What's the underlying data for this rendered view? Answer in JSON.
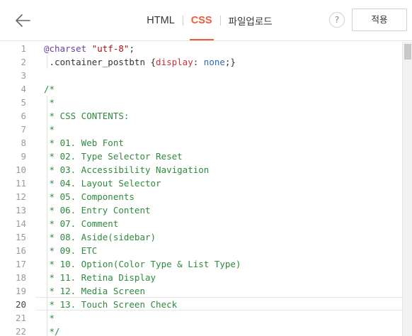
{
  "toolbar": {
    "tabs": [
      "HTML",
      "CSS",
      "파일업로드"
    ],
    "active_tab": "CSS",
    "help_label": "?",
    "apply_label": "적용"
  },
  "editor": {
    "current_line": 20,
    "lines": [
      {
        "num": "1",
        "tokens": [
          [
            "at",
            "@charset"
          ],
          [
            "punct",
            " "
          ],
          [
            "str",
            "\"utf-8\""
          ],
          [
            "punct",
            ";"
          ]
        ]
      },
      {
        "num": "2",
        "tokens": [
          [
            "sel",
            " .container_postbtn "
          ],
          [
            "punct",
            "{"
          ],
          [
            "prop",
            "display"
          ],
          [
            "punct",
            ": "
          ],
          [
            "val",
            "none"
          ],
          [
            "punct",
            ";}"
          ]
        ]
      },
      {
        "num": "3",
        "tokens": []
      },
      {
        "num": "4",
        "tokens": [
          [
            "comment",
            "/*"
          ]
        ]
      },
      {
        "num": "5",
        "tokens": [
          [
            "comment",
            " *"
          ]
        ]
      },
      {
        "num": "6",
        "tokens": [
          [
            "comment",
            " * CSS CONTENTS:"
          ]
        ]
      },
      {
        "num": "7",
        "tokens": [
          [
            "comment",
            " *"
          ]
        ]
      },
      {
        "num": "8",
        "tokens": [
          [
            "comment",
            " * 01. Web Font"
          ]
        ]
      },
      {
        "num": "9",
        "tokens": [
          [
            "comment",
            " * 02. Type Selector Reset"
          ]
        ]
      },
      {
        "num": "10",
        "tokens": [
          [
            "comment",
            " * 03. Accessibility Navigation"
          ]
        ]
      },
      {
        "num": "11",
        "tokens": [
          [
            "comment",
            " * 04. Layout Selector"
          ]
        ]
      },
      {
        "num": "12",
        "tokens": [
          [
            "comment",
            " * 05. Components"
          ]
        ]
      },
      {
        "num": "13",
        "tokens": [
          [
            "comment",
            " * 06. Entry Content"
          ]
        ]
      },
      {
        "num": "14",
        "tokens": [
          [
            "comment",
            " * 07. Comment"
          ]
        ]
      },
      {
        "num": "15",
        "tokens": [
          [
            "comment",
            " * 08. Aside(sidebar)"
          ]
        ]
      },
      {
        "num": "16",
        "tokens": [
          [
            "comment",
            " * 09. ETC"
          ]
        ]
      },
      {
        "num": "17",
        "tokens": [
          [
            "comment",
            " * 10. Option(Color Type & List Type)"
          ]
        ]
      },
      {
        "num": "18",
        "tokens": [
          [
            "comment",
            " * 11. Retina Display"
          ]
        ]
      },
      {
        "num": "19",
        "tokens": [
          [
            "comment",
            " * 12. Media Screen"
          ]
        ]
      },
      {
        "num": "20",
        "tokens": [
          [
            "comment",
            " * 13. Touch Screen Check"
          ]
        ]
      },
      {
        "num": "21",
        "tokens": [
          [
            "comment",
            " *"
          ]
        ]
      },
      {
        "num": "22",
        "tokens": [
          [
            "comment",
            " */"
          ]
        ]
      }
    ]
  },
  "icons": {
    "back": "arrow-left-icon",
    "help": "question-icon"
  },
  "colors": {
    "accent": "#ef5a3a",
    "comment": "#2e8a3c",
    "at_rule": "#6b3fa0",
    "string": "#a11",
    "property": "#c33",
    "value": "#2a6bb5",
    "line_number": "#9a9a9a"
  }
}
